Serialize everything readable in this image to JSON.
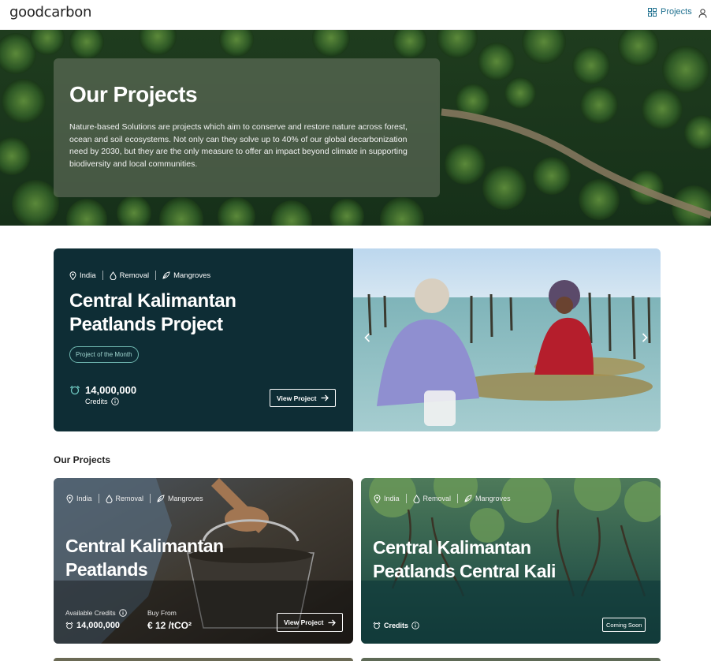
{
  "header": {
    "logo_text": "goodcarbon",
    "nav_projects_label": "Projects",
    "accent_color": "#1d6f8e"
  },
  "hero": {
    "title": "Our Projects",
    "description": "Nature-based Solutions are projects which aim to conserve and restore nature across forest, ocean and soil ecosystems. Not only can they solve up to 40% of our global decarbonization need by 2030, but they are the only measure to offer an impact beyond climate in supporting biodiversity and local communities."
  },
  "featured": {
    "tags": {
      "location": "India",
      "type": "Removal",
      "ecosystem": "Mangroves"
    },
    "title_line1": "Central Kalimantan",
    "title_line2": "Peatlands Project",
    "badge": "Project of the Month",
    "credits_value": "14,000,000",
    "credits_label": "Credits",
    "view_button": "View Project",
    "panel_color": "#0e2d35"
  },
  "projects_section": {
    "title": "Our Projects",
    "cards": [
      {
        "tags": {
          "location": "India",
          "type": "Removal",
          "ecosystem": "Mangroves"
        },
        "title_line1": "Central Kalimantan",
        "title_line2": "Peatlands",
        "available_label": "Available Credits",
        "available_value": "14,000,000",
        "buy_label": "Buy From",
        "buy_value": "€ 12 /tCO²",
        "button": "View Project"
      },
      {
        "tags": {
          "location": "India",
          "type": "Removal",
          "ecosystem": "Mangroves"
        },
        "title_line1": "Central Kalimantan",
        "title_line2": "Peatlands Central Kali",
        "credits_label": "Credits",
        "button": "Coming Soon"
      }
    ]
  }
}
